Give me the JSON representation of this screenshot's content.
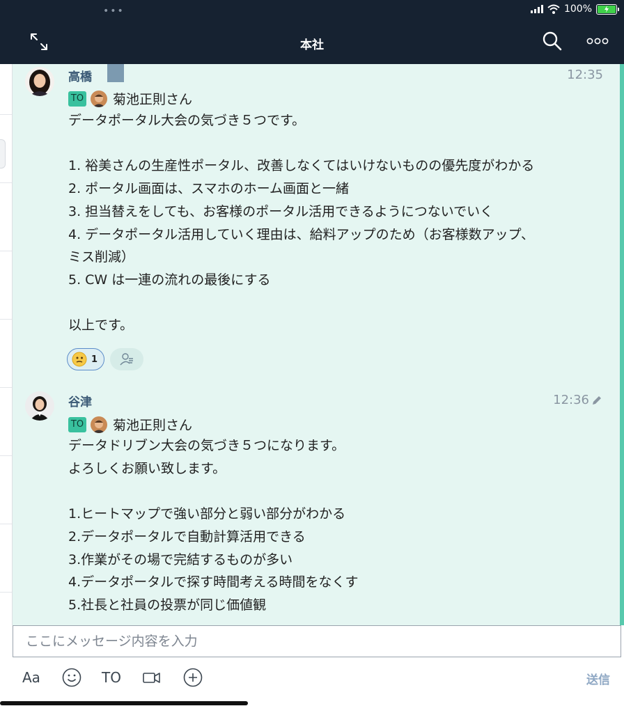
{
  "status_bar": {
    "dots": "•••",
    "battery_text": "100%"
  },
  "header": {
    "title": "本社"
  },
  "messages": [
    {
      "sender": "高橋",
      "time": "12:35",
      "to_label": "TO",
      "to_name": "菊池正則さん",
      "lines": [
        "データポータル大会の気づき５つです。",
        "",
        "1. 裕美さんの生産性ポータル、改善しなくてはいけないものの優先度がわかる",
        "2. ポータル画面は、スマホのホーム画面と一緒",
        "3. 担当替えをしても、お客様のポータル活用できるようにつないでいく",
        "4. データポータル活用していく理由は、給料アップのため（お客様数アップ、",
        "ミス削減）",
        "5. CW は一連の流れの最後にする",
        "",
        "以上です。"
      ],
      "reaction_count": "1"
    },
    {
      "sender": "谷津",
      "time": "12:36",
      "to_label": "TO",
      "to_name": "菊池正則さん",
      "lines": [
        "データドリブン大会の気づき５つになります。",
        "よろしくお願い致します。",
        "",
        "1.ヒートマップで強い部分と弱い部分がわかる",
        "2.データポータルで自動計算活用できる",
        "3.作業がその場で完結するものが多い",
        "4.データポータルで探す時間考える時間をなくす",
        "5.社長と社員の投票が同じ価値観"
      ]
    }
  ],
  "composer": {
    "placeholder": "ここにメッセージ内容を入力",
    "font_label": "Aa",
    "to_label": "TO",
    "send_label": "送信"
  },
  "colors": {
    "header_bg": "#162231",
    "chat_bg": "#e5f6f2",
    "accent": "#58c9ad",
    "to_badge": "#39c19e"
  }
}
